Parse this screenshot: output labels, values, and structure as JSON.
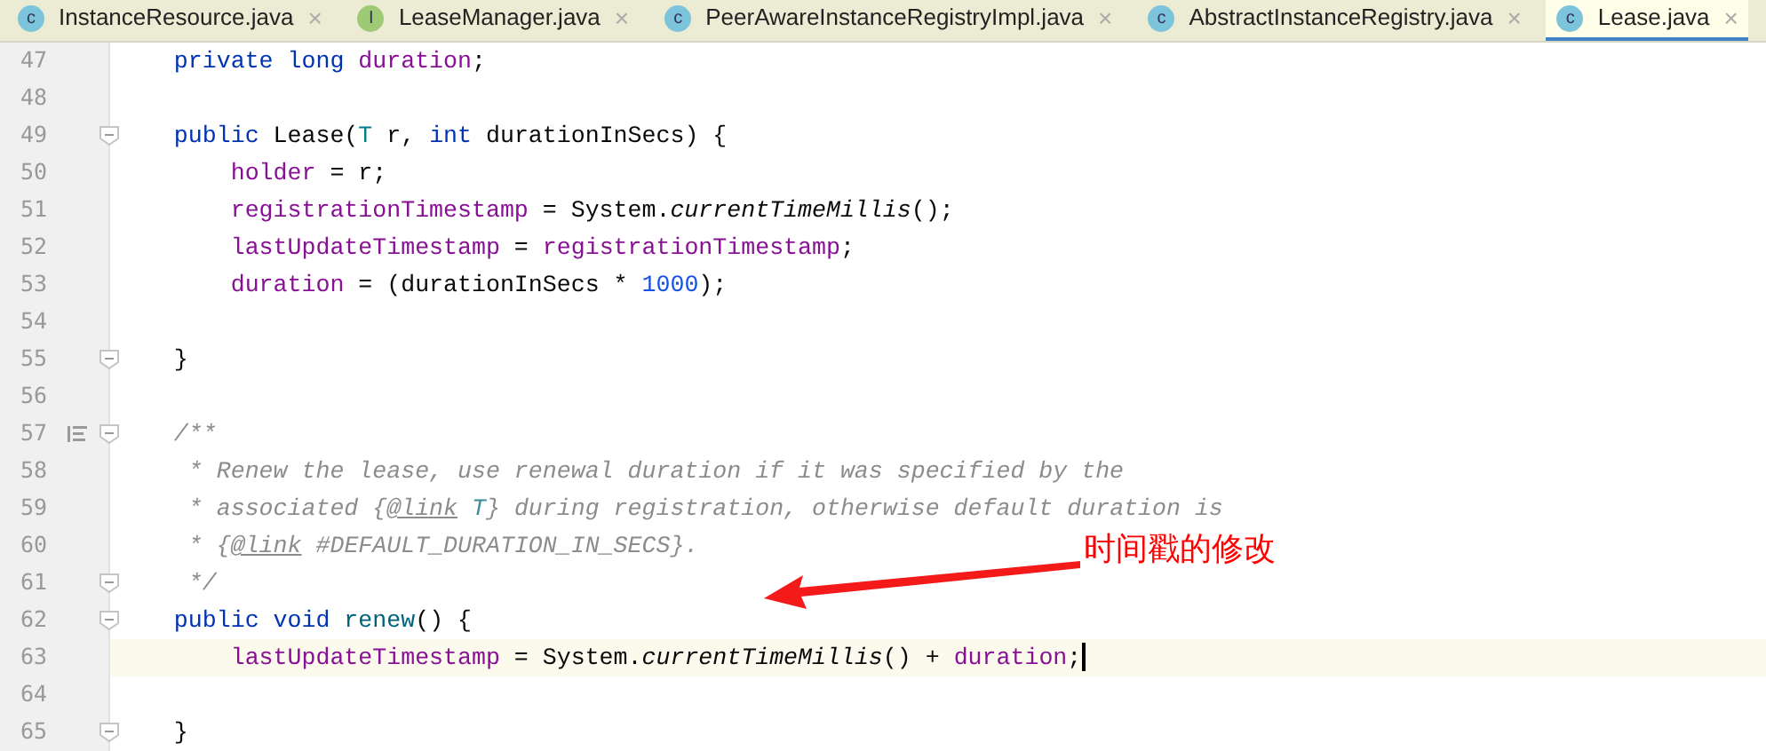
{
  "tabs": [
    {
      "label": "InstanceResource.java",
      "kind": "class",
      "icon_letter": "c",
      "selected": false
    },
    {
      "label": "LeaseManager.java",
      "kind": "interface",
      "icon_letter": "I",
      "selected": false
    },
    {
      "label": "PeerAwareInstanceRegistryImpl.java",
      "kind": "class",
      "icon_letter": "c",
      "selected": false
    },
    {
      "label": "AbstractInstanceRegistry.java",
      "kind": "class",
      "icon_letter": "c",
      "selected": false
    },
    {
      "label": "Lease.java",
      "kind": "class",
      "icon_letter": "c",
      "selected": true
    }
  ],
  "close_glyph": "×",
  "lines": [
    {
      "number": "47",
      "fold": false,
      "current": false,
      "doc_icon": false,
      "tokens": [
        {
          "text": "    private long",
          "kind": "keyword"
        },
        {
          "text": " duration",
          "kind": "field"
        },
        {
          "text": ";",
          "kind": "plain"
        }
      ]
    },
    {
      "number": "48",
      "fold": false,
      "current": false,
      "doc_icon": false
    },
    {
      "number": "49",
      "fold": true,
      "current": false,
      "doc_icon": false,
      "tokens": [
        {
          "text": "    public",
          "kind": "keyword"
        },
        {
          "text": " Lease(",
          "kind": "plain"
        },
        {
          "text": "T",
          "kind": "type"
        },
        {
          "text": " r, ",
          "kind": "plain"
        },
        {
          "text": "int",
          "kind": "keyword"
        },
        {
          "text": " durationInSecs) {",
          "kind": "plain"
        }
      ]
    },
    {
      "number": "50",
      "fold": false,
      "current": false,
      "doc_icon": false,
      "tokens": [
        {
          "text": "        holder",
          "kind": "field"
        },
        {
          "text": " = r;",
          "kind": "plain"
        }
      ]
    },
    {
      "number": "51",
      "fold": false,
      "current": false,
      "doc_icon": false,
      "tokens": [
        {
          "text": "        registrationTimestamp",
          "kind": "field"
        },
        {
          "text": " = System.",
          "kind": "plain"
        },
        {
          "text": "currentTimeMillis",
          "kind": "static"
        },
        {
          "text": "();",
          "kind": "plain"
        }
      ]
    },
    {
      "number": "52",
      "fold": false,
      "current": false,
      "doc_icon": false,
      "tokens": [
        {
          "text": "        lastUpdateTimestamp",
          "kind": "field"
        },
        {
          "text": " = ",
          "kind": "plain"
        },
        {
          "text": "registrationTimestamp",
          "kind": "field"
        },
        {
          "text": ";",
          "kind": "plain"
        }
      ]
    },
    {
      "number": "53",
      "fold": false,
      "current": false,
      "doc_icon": false,
      "tokens": [
        {
          "text": "        duration",
          "kind": "field"
        },
        {
          "text": " = (durationInSecs * ",
          "kind": "plain"
        },
        {
          "text": "1000",
          "kind": "number"
        },
        {
          "text": ");",
          "kind": "plain"
        }
      ]
    },
    {
      "number": "54",
      "fold": false,
      "current": false,
      "doc_icon": false
    },
    {
      "number": "55",
      "fold": true,
      "current": false,
      "doc_icon": false,
      "tokens": [
        {
          "text": "    }",
          "kind": "plain"
        }
      ]
    },
    {
      "number": "56",
      "fold": false,
      "current": false,
      "doc_icon": false
    },
    {
      "number": "57",
      "fold": true,
      "current": false,
      "doc_icon": true,
      "tokens": [
        {
          "text": "    /**",
          "kind": "comment"
        }
      ]
    },
    {
      "number": "58",
      "fold": false,
      "current": false,
      "doc_icon": false,
      "tokens": [
        {
          "text": "     * Renew the lease, use renewal duration if it was specified by the",
          "kind": "comment"
        }
      ]
    },
    {
      "number": "59",
      "fold": false,
      "current": false,
      "doc_icon": false,
      "tokens": [
        {
          "text": "     * associated {",
          "kind": "comment"
        },
        {
          "text": "@link",
          "kind": "doc_tag"
        },
        {
          "text": " T",
          "kind": "doc_ref"
        },
        {
          "text": "} during registration, otherwise default duration is",
          "kind": "comment"
        }
      ]
    },
    {
      "number": "60",
      "fold": false,
      "current": false,
      "doc_icon": false,
      "tokens": [
        {
          "text": "     * {",
          "kind": "comment"
        },
        {
          "text": "@link",
          "kind": "doc_tag"
        },
        {
          "text": " #DEFAULT_DURATION_IN_SECS}.",
          "kind": "comment"
        }
      ]
    },
    {
      "number": "61",
      "fold": true,
      "current": false,
      "doc_icon": false,
      "tokens": [
        {
          "text": "     */",
          "kind": "comment"
        }
      ]
    },
    {
      "number": "62",
      "fold": true,
      "current": false,
      "doc_icon": false,
      "tokens": [
        {
          "text": "    public void",
          "kind": "keyword"
        },
        {
          "text": " renew",
          "kind": "method"
        },
        {
          "text": "() {",
          "kind": "plain"
        }
      ]
    },
    {
      "number": "63",
      "fold": false,
      "current": true,
      "doc_icon": false,
      "tokens": [
        {
          "text": "        lastUpdateTimestamp",
          "kind": "field"
        },
        {
          "text": " = System.",
          "kind": "plain"
        },
        {
          "text": "currentTimeMillis",
          "kind": "static"
        },
        {
          "text": "() + ",
          "kind": "plain"
        },
        {
          "text": "duration",
          "kind": "field"
        },
        {
          "text": ";",
          "kind": "plain"
        }
      ]
    },
    {
      "number": "64",
      "fold": false,
      "current": false,
      "doc_icon": false
    },
    {
      "number": "65",
      "fold": true,
      "current": false,
      "doc_icon": false,
      "tokens": [
        {
          "text": "    }",
          "kind": "plain"
        }
      ]
    }
  ],
  "annotation": {
    "text": "时间戳的修改"
  }
}
